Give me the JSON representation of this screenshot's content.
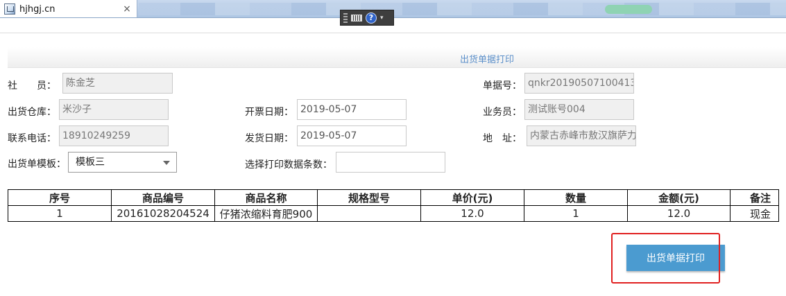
{
  "browser": {
    "tab_title": "hjhgj.cn",
    "close_glyph": "×"
  },
  "toolbar": {
    "icons": [
      "grip-icon",
      "keyboard-icon",
      "help-icon",
      "dropdown-icon"
    ],
    "help_glyph": "?",
    "drop_glyph": "▾"
  },
  "page": {
    "title": "出货单据打印"
  },
  "form": {
    "member_label": "社　　员：",
    "member_value": "陈金芝",
    "warehouse_label": "出货仓库：",
    "warehouse_value": "米沙子",
    "phone_label": "联系电话：",
    "phone_value": "18910249259",
    "template_label": "出货单模板：",
    "template_value": "模板三",
    "invoice_date_label": "开票日期：",
    "invoice_date_value": "2019-05-07",
    "ship_date_label": "发货日期：",
    "ship_date_value": "2019-05-07",
    "print_count_label": "选择打印数据条数：",
    "print_count_value": "",
    "doc_no_label": "单据号：",
    "doc_no_value": "qnkr20190507100413",
    "salesman_label": "业务员：",
    "salesman_value": "测试账号004",
    "address_label": "地　址：",
    "address_value": "内蒙古赤峰市敖汉旗萨力"
  },
  "table": {
    "headers": [
      "序号",
      "商品编号",
      "商品名称",
      "规格型号",
      "单价(元)",
      "数量",
      "金额(元)",
      "备注"
    ],
    "rows": [
      [
        "1",
        "20161028204524",
        "仔猪浓缩料育肥900",
        "",
        "12.0",
        "1",
        "12.0",
        "现金"
      ]
    ]
  },
  "actions": {
    "print_label": "出货单据打印"
  },
  "colors": {
    "accent": "#4b9bd0",
    "title": "#5b8fc9",
    "highlight": "#e01f1f"
  }
}
